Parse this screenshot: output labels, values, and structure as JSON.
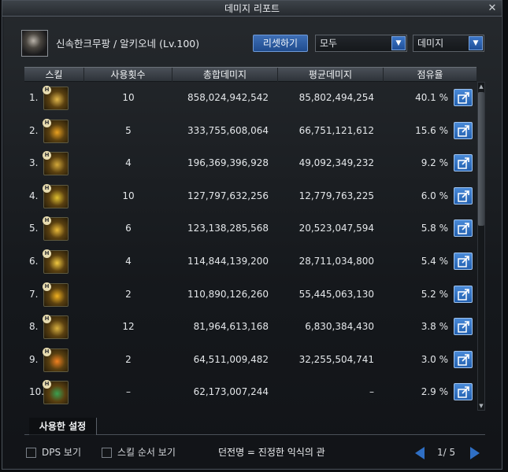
{
  "window": {
    "title": "데미지 리포트",
    "close": "✕"
  },
  "header": {
    "character": "신속한크무팡 / 알키오네 (Lv.100)",
    "reset_label": "리셋하기",
    "filter_value": "모두",
    "sort_value": "데미지"
  },
  "table": {
    "columns": [
      "스킬",
      "사용횟수",
      "총합데미지",
      "평균데미지",
      "점유율"
    ],
    "rows": [
      {
        "rank": "1.",
        "icon": "skill-1-icon",
        "color": "#e0b64a",
        "uses": "10",
        "total": "858,024,942,542",
        "avg": "85,802,494,254",
        "share": "40.1 %"
      },
      {
        "rank": "2.",
        "icon": "skill-2-icon",
        "color": "#e8a020",
        "uses": "5",
        "total": "333,755,608,064",
        "avg": "66,751,121,612",
        "share": "15.6 %"
      },
      {
        "rank": "3.",
        "icon": "skill-3-icon",
        "color": "#d2a83a",
        "uses": "4",
        "total": "196,369,396,928",
        "avg": "49,092,349,232",
        "share": "9.2 %"
      },
      {
        "rank": "4.",
        "icon": "skill-4-icon",
        "color": "#e0c030",
        "uses": "10",
        "total": "127,797,632,256",
        "avg": "12,779,763,225",
        "share": "6.0 %"
      },
      {
        "rank": "5.",
        "icon": "skill-5-icon",
        "color": "#e8b838",
        "uses": "6",
        "total": "123,138,285,568",
        "avg": "20,523,047,594",
        "share": "5.8 %"
      },
      {
        "rank": "6.",
        "icon": "skill-6-icon",
        "color": "#f0c840",
        "uses": "4",
        "total": "114,844,139,200",
        "avg": "28,711,034,800",
        "share": "5.4 %"
      },
      {
        "rank": "7.",
        "icon": "skill-7-icon",
        "color": "#f0b020",
        "uses": "2",
        "total": "110,890,126,260",
        "avg": "55,445,063,130",
        "share": "5.2 %"
      },
      {
        "rank": "8.",
        "icon": "skill-8-icon",
        "color": "#d8b040",
        "uses": "12",
        "total": "81,964,613,168",
        "avg": "6,830,384,430",
        "share": "3.8 %"
      },
      {
        "rank": "9.",
        "icon": "skill-9-icon",
        "color": "#f08020",
        "uses": "2",
        "total": "64,511,009,482",
        "avg": "32,255,504,741",
        "share": "3.0 %"
      },
      {
        "rank": "10.",
        "icon": "skill-10-icon",
        "color": "#3aa050",
        "uses": "–",
        "total": "62,173,007,244",
        "avg": "–",
        "share": "2.9 %"
      }
    ]
  },
  "tab": {
    "label": "사용한 설정"
  },
  "footer": {
    "dps_label": "DPS 보기",
    "skill_order_label": "스킬 순서 보기",
    "dungeon": "던전명 = 진정한 익식의 관",
    "page": "1/ 5"
  }
}
